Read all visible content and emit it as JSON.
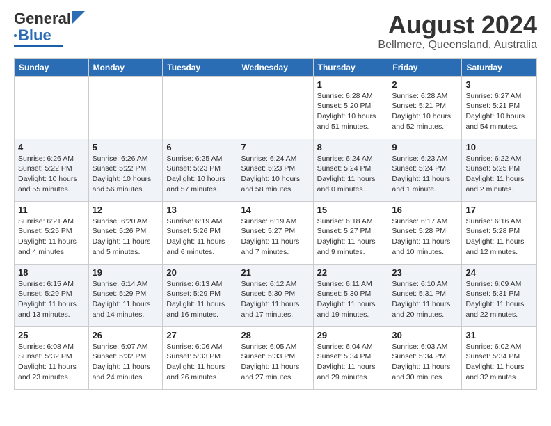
{
  "header": {
    "logo_line1": "General",
    "logo_line2": "Blue",
    "month": "August 2024",
    "location": "Bellmere, Queensland, Australia"
  },
  "weekdays": [
    "Sunday",
    "Monday",
    "Tuesday",
    "Wednesday",
    "Thursday",
    "Friday",
    "Saturday"
  ],
  "weeks": [
    [
      {
        "day": "",
        "info": ""
      },
      {
        "day": "",
        "info": ""
      },
      {
        "day": "",
        "info": ""
      },
      {
        "day": "",
        "info": ""
      },
      {
        "day": "1",
        "info": "Sunrise: 6:28 AM\nSunset: 5:20 PM\nDaylight: 10 hours and 51 minutes."
      },
      {
        "day": "2",
        "info": "Sunrise: 6:28 AM\nSunset: 5:21 PM\nDaylight: 10 hours and 52 minutes."
      },
      {
        "day": "3",
        "info": "Sunrise: 6:27 AM\nSunset: 5:21 PM\nDaylight: 10 hours and 54 minutes."
      }
    ],
    [
      {
        "day": "4",
        "info": "Sunrise: 6:26 AM\nSunset: 5:22 PM\nDaylight: 10 hours and 55 minutes."
      },
      {
        "day": "5",
        "info": "Sunrise: 6:26 AM\nSunset: 5:22 PM\nDaylight: 10 hours and 56 minutes."
      },
      {
        "day": "6",
        "info": "Sunrise: 6:25 AM\nSunset: 5:23 PM\nDaylight: 10 hours and 57 minutes."
      },
      {
        "day": "7",
        "info": "Sunrise: 6:24 AM\nSunset: 5:23 PM\nDaylight: 10 hours and 58 minutes."
      },
      {
        "day": "8",
        "info": "Sunrise: 6:24 AM\nSunset: 5:24 PM\nDaylight: 11 hours and 0 minutes."
      },
      {
        "day": "9",
        "info": "Sunrise: 6:23 AM\nSunset: 5:24 PM\nDaylight: 11 hours and 1 minute."
      },
      {
        "day": "10",
        "info": "Sunrise: 6:22 AM\nSunset: 5:25 PM\nDaylight: 11 hours and 2 minutes."
      }
    ],
    [
      {
        "day": "11",
        "info": "Sunrise: 6:21 AM\nSunset: 5:25 PM\nDaylight: 11 hours and 4 minutes."
      },
      {
        "day": "12",
        "info": "Sunrise: 6:20 AM\nSunset: 5:26 PM\nDaylight: 11 hours and 5 minutes."
      },
      {
        "day": "13",
        "info": "Sunrise: 6:19 AM\nSunset: 5:26 PM\nDaylight: 11 hours and 6 minutes."
      },
      {
        "day": "14",
        "info": "Sunrise: 6:19 AM\nSunset: 5:27 PM\nDaylight: 11 hours and 7 minutes."
      },
      {
        "day": "15",
        "info": "Sunrise: 6:18 AM\nSunset: 5:27 PM\nDaylight: 11 hours and 9 minutes."
      },
      {
        "day": "16",
        "info": "Sunrise: 6:17 AM\nSunset: 5:28 PM\nDaylight: 11 hours and 10 minutes."
      },
      {
        "day": "17",
        "info": "Sunrise: 6:16 AM\nSunset: 5:28 PM\nDaylight: 11 hours and 12 minutes."
      }
    ],
    [
      {
        "day": "18",
        "info": "Sunrise: 6:15 AM\nSunset: 5:29 PM\nDaylight: 11 hours and 13 minutes."
      },
      {
        "day": "19",
        "info": "Sunrise: 6:14 AM\nSunset: 5:29 PM\nDaylight: 11 hours and 14 minutes."
      },
      {
        "day": "20",
        "info": "Sunrise: 6:13 AM\nSunset: 5:29 PM\nDaylight: 11 hours and 16 minutes."
      },
      {
        "day": "21",
        "info": "Sunrise: 6:12 AM\nSunset: 5:30 PM\nDaylight: 11 hours and 17 minutes."
      },
      {
        "day": "22",
        "info": "Sunrise: 6:11 AM\nSunset: 5:30 PM\nDaylight: 11 hours and 19 minutes."
      },
      {
        "day": "23",
        "info": "Sunrise: 6:10 AM\nSunset: 5:31 PM\nDaylight: 11 hours and 20 minutes."
      },
      {
        "day": "24",
        "info": "Sunrise: 6:09 AM\nSunset: 5:31 PM\nDaylight: 11 hours and 22 minutes."
      }
    ],
    [
      {
        "day": "25",
        "info": "Sunrise: 6:08 AM\nSunset: 5:32 PM\nDaylight: 11 hours and 23 minutes."
      },
      {
        "day": "26",
        "info": "Sunrise: 6:07 AM\nSunset: 5:32 PM\nDaylight: 11 hours and 24 minutes."
      },
      {
        "day": "27",
        "info": "Sunrise: 6:06 AM\nSunset: 5:33 PM\nDaylight: 11 hours and 26 minutes."
      },
      {
        "day": "28",
        "info": "Sunrise: 6:05 AM\nSunset: 5:33 PM\nDaylight: 11 hours and 27 minutes."
      },
      {
        "day": "29",
        "info": "Sunrise: 6:04 AM\nSunset: 5:34 PM\nDaylight: 11 hours and 29 minutes."
      },
      {
        "day": "30",
        "info": "Sunrise: 6:03 AM\nSunset: 5:34 PM\nDaylight: 11 hours and 30 minutes."
      },
      {
        "day": "31",
        "info": "Sunrise: 6:02 AM\nSunset: 5:34 PM\nDaylight: 11 hours and 32 minutes."
      }
    ]
  ]
}
